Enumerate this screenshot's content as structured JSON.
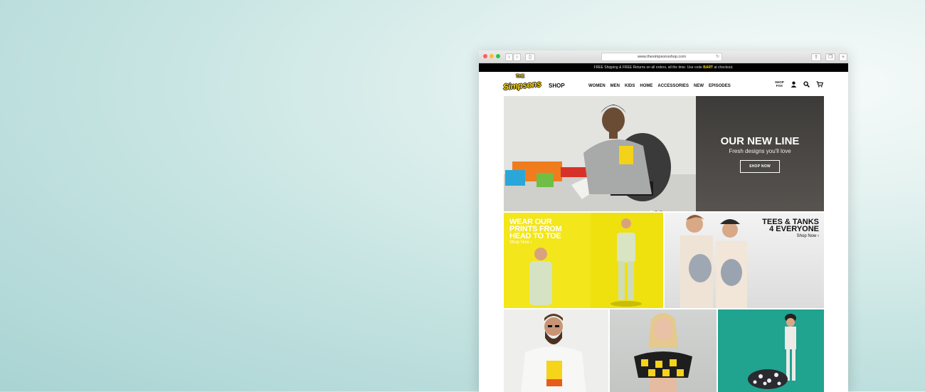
{
  "browser": {
    "url": "www.thesimpsonsshop.com"
  },
  "promo": {
    "text_before": "FREE Shipping & FREE Returns on all orders, all the time. Use code ",
    "code": "BART",
    "text_after": " at checkout."
  },
  "header": {
    "logo_the": "THE",
    "logo_main": "Simpsons",
    "logo_shop": "SHOP",
    "nav": [
      "WOMEN",
      "MEN",
      "KIDS",
      "HOME",
      "ACCESSORIES",
      "NEW",
      "EPISODES"
    ],
    "shop_fox_line1": "SHOP",
    "shop_fox_line2": "FOX"
  },
  "hero": {
    "title": "OUR NEW LINE",
    "subtitle": "Fresh designs you'll love",
    "button": "SHOP NOW"
  },
  "tiles": {
    "prints": {
      "line1": "WEAR OUR",
      "line2": "PRINTS FROM",
      "line3": "HEAD TO TOE",
      "link": "Shop Now ›"
    },
    "tees": {
      "line1": "TEES & TANKS",
      "line2": "4 EVERYONE",
      "link": "Shop Now ›"
    }
  },
  "icons": {
    "account": "user-icon",
    "search": "search-icon",
    "cart": "cart-icon"
  },
  "colors": {
    "brand_yellow": "#ffd90f",
    "promo_bg": "#000000",
    "hero_panel": "#48453f",
    "teal_tile": "#20a38f"
  }
}
